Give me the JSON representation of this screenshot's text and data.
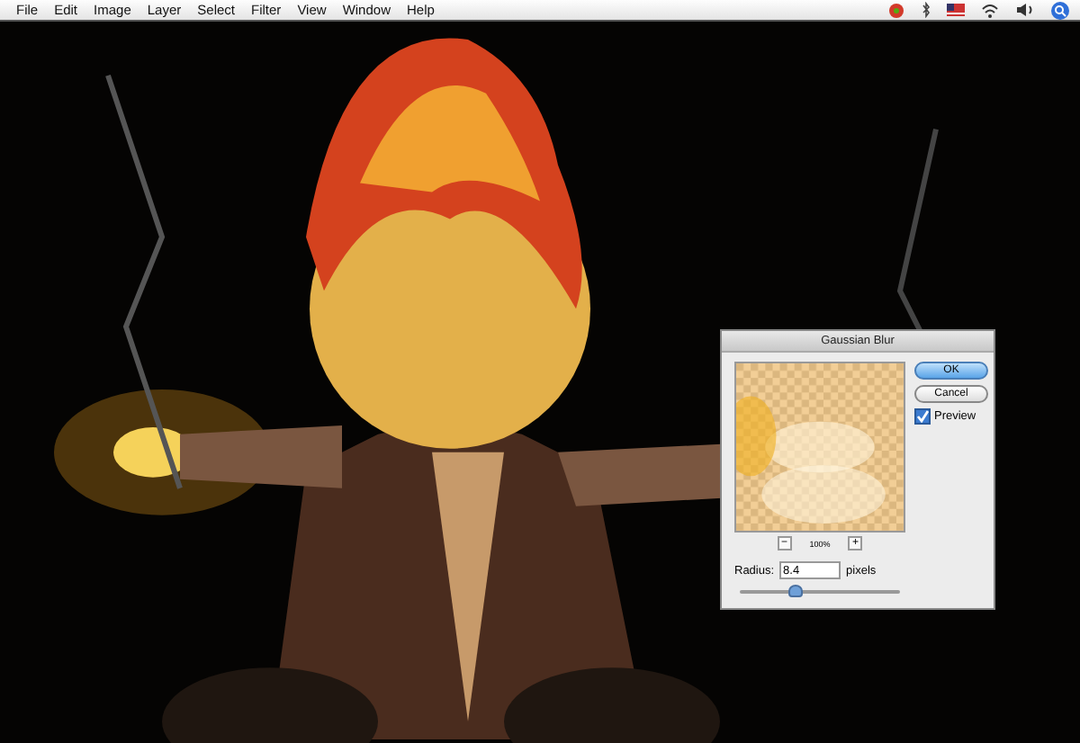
{
  "menu_bar": {
    "items": [
      "File",
      "Edit",
      "Image",
      "Layer",
      "Select",
      "Filter",
      "View",
      "Window",
      "Help"
    ]
  },
  "dialog": {
    "title": "Gaussian Blur",
    "ok_button": "OK",
    "cancel_button": "Cancel",
    "preview": {
      "label": "Preview",
      "checked": true
    },
    "zoom_out": "−",
    "zoom_level": "100%",
    "zoom_in": "+",
    "radius": {
      "label": "Radius:",
      "value": "8.4",
      "unit": "pixels",
      "level": 0.35
    }
  }
}
